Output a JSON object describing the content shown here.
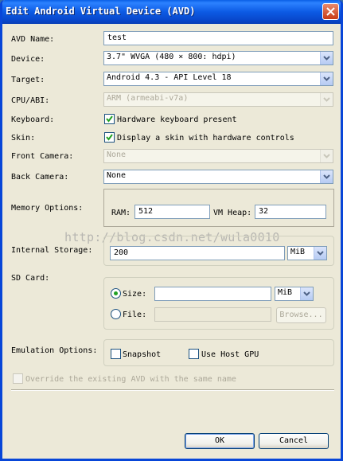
{
  "window": {
    "title": "Edit Android Virtual Device (AVD)"
  },
  "avd_name": {
    "label": "AVD Name:",
    "value": "test"
  },
  "device": {
    "label": "Device:",
    "value": "3.7\" WVGA (480 × 800: hdpi)"
  },
  "target": {
    "label": "Target:",
    "value": "Android 4.3 - API Level 18"
  },
  "cpu_abi": {
    "label": "CPU/ABI:",
    "value": "ARM (armeabi-v7a)"
  },
  "keyboard": {
    "label": "Keyboard:",
    "option": "Hardware keyboard present",
    "checked": true
  },
  "skin": {
    "label": "Skin:",
    "option": "Display a skin with hardware controls",
    "checked": true
  },
  "front_camera": {
    "label": "Front Camera:",
    "value": "None"
  },
  "back_camera": {
    "label": "Back Camera:",
    "value": "None"
  },
  "memory": {
    "label": "Memory Options:",
    "ram_label": "RAM:",
    "ram_value": "512",
    "vm_heap_label": "VM Heap:",
    "vm_heap_value": "32"
  },
  "watermark": "http://blog.csdn.net/wula0010",
  "internal_storage": {
    "label": "Internal Storage:",
    "value": "200",
    "unit": "MiB"
  },
  "sd_card": {
    "label": "SD Card:",
    "size_label": "Size:",
    "size_value": "",
    "size_unit": "MiB",
    "file_label": "File:",
    "file_value": "",
    "browse_label": "Browse...",
    "selected": "size"
  },
  "emulation": {
    "label": "Emulation Options:",
    "snapshot": "Snapshot",
    "use_host_gpu": "Use Host GPU"
  },
  "override": {
    "label": "Override the existing AVD with the same name"
  },
  "buttons": {
    "ok": "OK",
    "cancel": "Cancel"
  },
  "colors": {
    "title_bar": "#0a5fe6",
    "dialog_bg": "#ece9d8",
    "close_button": "#c83b16",
    "radio_dot": "#21a121"
  }
}
